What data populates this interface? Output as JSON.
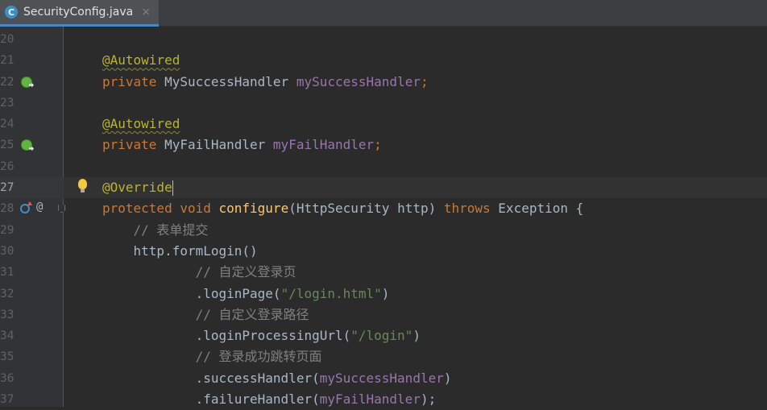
{
  "tab": {
    "icon_letter": "C",
    "file_name": "SecurityConfig.java",
    "close_glyph": "×"
  },
  "lines": [
    {
      "num": "20",
      "tokens": []
    },
    {
      "num": "21",
      "tokens": [
        {
          "t": "@Autowired",
          "c": "ann"
        }
      ]
    },
    {
      "num": "22",
      "tokens": [
        {
          "t": "private ",
          "c": "kw"
        },
        {
          "t": "MySuccessHandler ",
          "c": ""
        },
        {
          "t": "mySuccessHandler",
          "c": "field"
        },
        {
          "t": ";",
          "c": "kw"
        }
      ]
    },
    {
      "num": "23",
      "tokens": []
    },
    {
      "num": "24",
      "tokens": [
        {
          "t": "@Autowired",
          "c": "ann"
        }
      ]
    },
    {
      "num": "25",
      "tokens": [
        {
          "t": "private ",
          "c": "kw"
        },
        {
          "t": "MyFailHandler ",
          "c": ""
        },
        {
          "t": "myFailHandler",
          "c": "field"
        },
        {
          "t": ";",
          "c": "kw"
        }
      ]
    },
    {
      "num": "26",
      "tokens": []
    },
    {
      "num": "27",
      "tokens": [
        {
          "t": "@Override",
          "c": "ann-plain"
        }
      ]
    },
    {
      "num": "28",
      "tokens": [
        {
          "t": "protected ",
          "c": "kw"
        },
        {
          "t": "void ",
          "c": "kw"
        },
        {
          "t": "configure",
          "c": "method"
        },
        {
          "t": "(HttpSecurity http) ",
          "c": ""
        },
        {
          "t": "throws ",
          "c": "kw"
        },
        {
          "t": "Exception {",
          "c": ""
        }
      ]
    },
    {
      "num": "29",
      "tokens": [
        {
          "t": "    ",
          "c": ""
        },
        {
          "t": "// 表单提交",
          "c": "comment"
        }
      ]
    },
    {
      "num": "30",
      "tokens": [
        {
          "t": "    http.formLogin()",
          "c": ""
        }
      ]
    },
    {
      "num": "31",
      "tokens": [
        {
          "t": "            ",
          "c": ""
        },
        {
          "t": "// 自定义登录页",
          "c": "comment"
        }
      ]
    },
    {
      "num": "32",
      "tokens": [
        {
          "t": "            .loginPage(",
          "c": ""
        },
        {
          "t": "\"/login.html\"",
          "c": "str"
        },
        {
          "t": ")",
          "c": ""
        }
      ]
    },
    {
      "num": "33",
      "tokens": [
        {
          "t": "            ",
          "c": ""
        },
        {
          "t": "// 自定义登录路径",
          "c": "comment"
        }
      ]
    },
    {
      "num": "34",
      "tokens": [
        {
          "t": "            .loginProcessingUrl(",
          "c": ""
        },
        {
          "t": "\"/login\"",
          "c": "str"
        },
        {
          "t": ")",
          "c": ""
        }
      ]
    },
    {
      "num": "35",
      "tokens": [
        {
          "t": "            ",
          "c": ""
        },
        {
          "t": "// 登录成功跳转页面",
          "c": "comment"
        }
      ]
    },
    {
      "num": "36",
      "tokens": [
        {
          "t": "            .successHandler(",
          "c": ""
        },
        {
          "t": "mySuccessHandler",
          "c": "field"
        },
        {
          "t": ")",
          "c": ""
        }
      ]
    },
    {
      "num": "37",
      "tokens": [
        {
          "t": "            .failureHandler(",
          "c": ""
        },
        {
          "t": "myFailHandler",
          "c": "field"
        },
        {
          "t": ");",
          "c": ""
        }
      ]
    }
  ],
  "gutter_icons": {
    "22": [
      "bean-navigate-icon"
    ],
    "25": [
      "bean-navigate-icon"
    ],
    "27": [
      "intention-bulb-icon"
    ],
    "28": [
      "override-method-icon",
      "annotation-at-icon",
      "fold-icon"
    ]
  },
  "gutter_glyphs": {
    "at": "@"
  },
  "current_line": "27"
}
